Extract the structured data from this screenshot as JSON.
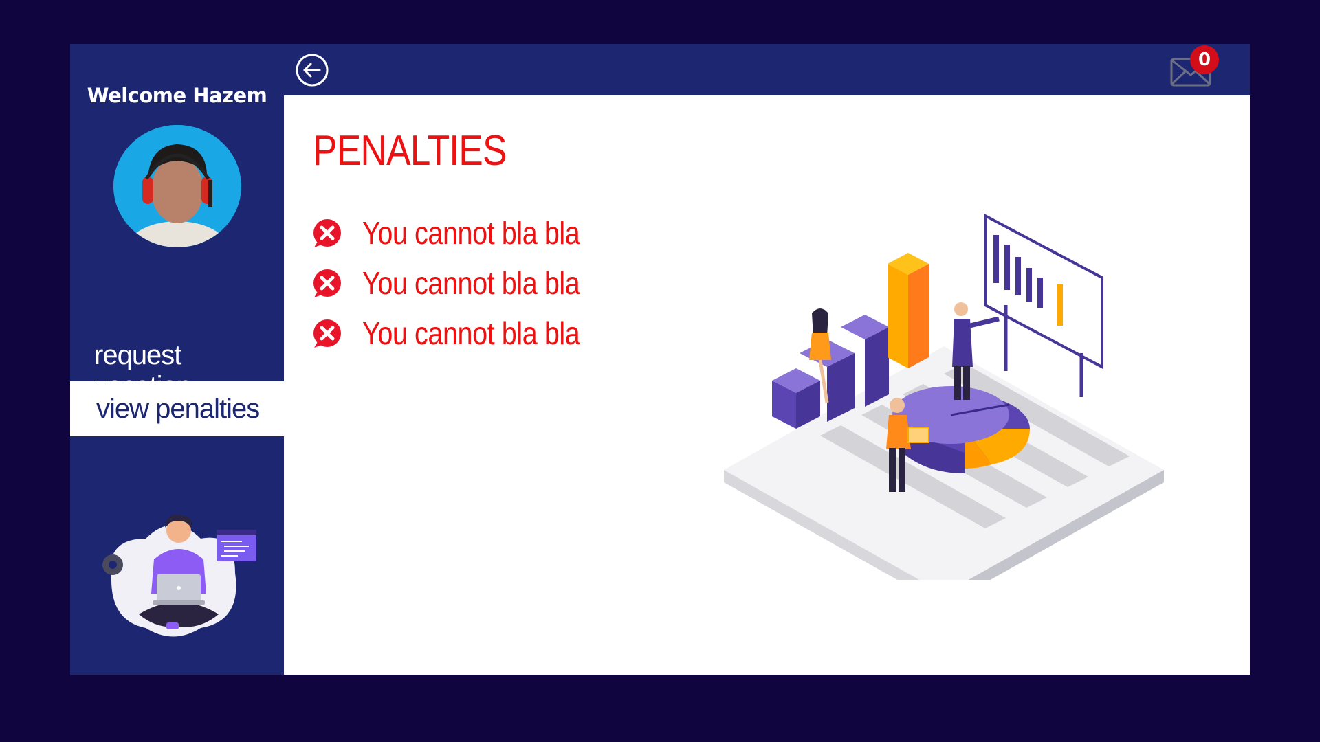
{
  "sidebar": {
    "welcome_text": "Welcome Hazem",
    "nav": {
      "request_vacation": "request vacation",
      "view_penalties": "view penalties"
    }
  },
  "topbar": {
    "back_icon": "back-arrow-icon",
    "mail_icon": "envelope-icon",
    "unread_count": "0"
  },
  "main": {
    "title": "PENALTIES",
    "penalties": [
      "You cannot bla bla",
      "You cannot bla bla",
      "You cannot bla bla"
    ]
  },
  "colors": {
    "background": "#10053e",
    "sidebar": "#1c2671",
    "accent_red": "#ee1111",
    "badge_red": "#d30d1a"
  }
}
